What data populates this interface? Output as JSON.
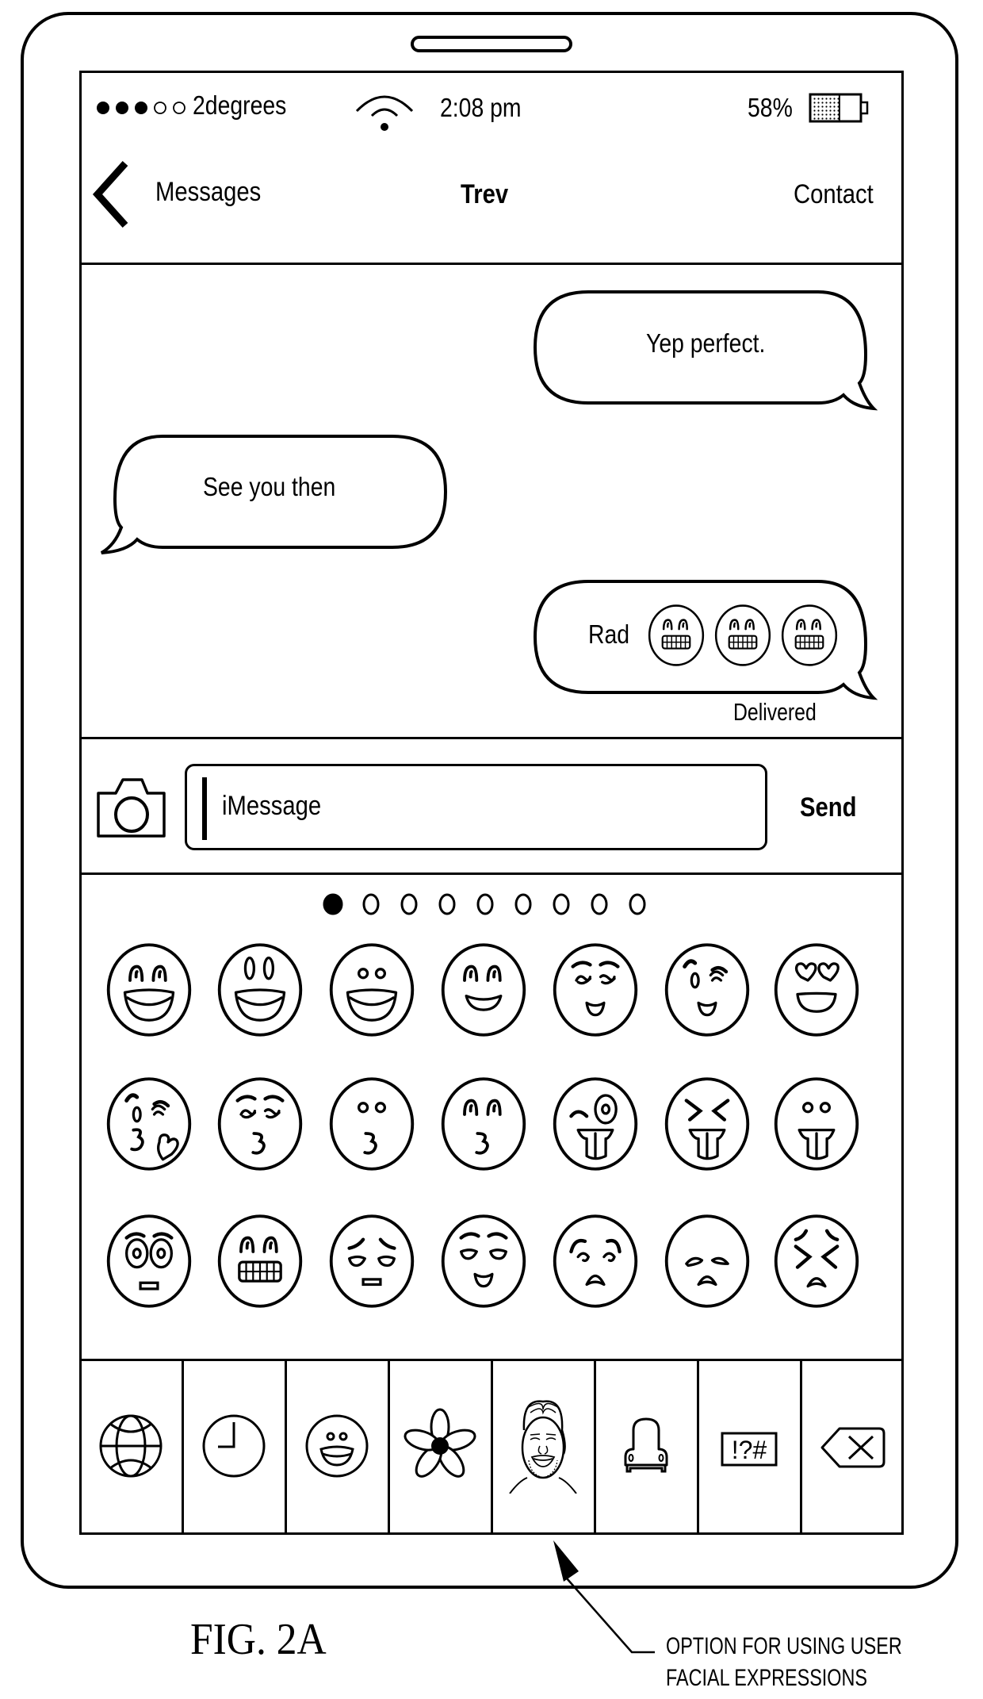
{
  "figure": {
    "label": "FIG. 2A",
    "callout_line1": "OPTION FOR USING USER",
    "callout_line2": "FACIAL EXPRESSIONS"
  },
  "status_bar": {
    "signal_filled": 3,
    "signal_total": 5,
    "carrier": "2degrees",
    "wifi_icon": "wifi-icon",
    "time": "2:08 pm",
    "battery_percent_label": "58%",
    "battery_level": 0.58
  },
  "nav_bar": {
    "back_icon": "chevron-left-icon",
    "back_label": "Messages",
    "title": "Trev",
    "right_label": "Contact"
  },
  "messages": [
    {
      "direction": "outgoing",
      "text": "Yep perfect."
    },
    {
      "direction": "incoming",
      "text": "See you then"
    },
    {
      "direction": "outgoing",
      "text": "Rad",
      "emojis": [
        "grimacing-face",
        "grimacing-face",
        "grimacing-face"
      ]
    }
  ],
  "delivery_status": "Delivered",
  "composer": {
    "camera_icon": "camera-icon",
    "placeholder": "iMessage",
    "send_label": "Send"
  },
  "emoji_keyboard": {
    "page_count": 9,
    "active_page": 1,
    "rows": [
      [
        "grinning-smiling-eyes",
        "grinning-big-eyes",
        "grinning-face",
        "smiling-eyes",
        "relieved-smile",
        "winking-smile",
        "heart-eyes"
      ],
      [
        "kissing-heart",
        "kissing-closed-eyes",
        "kissing-face",
        "kissing-smiling-eyes",
        "winking-tongue",
        "squinting-tongue",
        "tongue-out"
      ],
      [
        "flushed-face",
        "grimacing-face",
        "pensive-face",
        "relieved-face",
        "confused-face",
        "disappointed-face",
        "confounded-face"
      ]
    ],
    "tabs": [
      {
        "name": "globe",
        "icon": "globe-icon"
      },
      {
        "name": "recent",
        "icon": "clock-icon"
      },
      {
        "name": "smileys",
        "icon": "smiley-icon"
      },
      {
        "name": "nature",
        "icon": "flower-icon"
      },
      {
        "name": "user-facial-expressions",
        "icon": "user-face-icon"
      },
      {
        "name": "objects",
        "icon": "chair-icon"
      },
      {
        "name": "symbols",
        "icon": "symbols-icon",
        "label": "!?#"
      },
      {
        "name": "delete",
        "icon": "backspace-icon"
      }
    ]
  }
}
